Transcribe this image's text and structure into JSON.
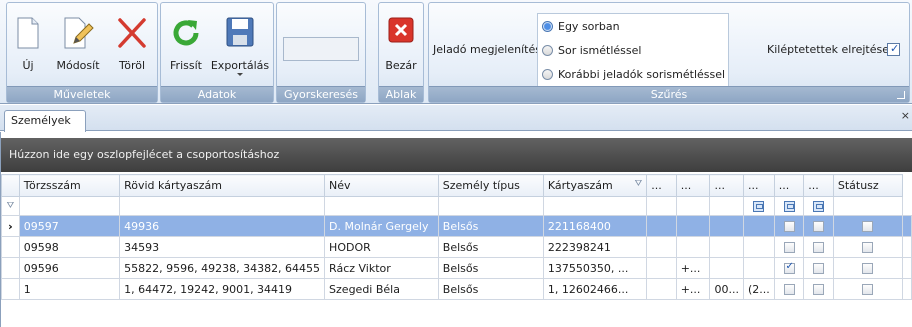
{
  "ribbon": {
    "groups": {
      "muveletek": "Műveletek",
      "adatok": "Adatok",
      "gyorskereses": "Gyorskeresés",
      "ablak": "Ablak",
      "szures": "Szűrés"
    },
    "buttons": {
      "uj": "Új",
      "modosit": "Módosít",
      "torol": "Töröl",
      "frissit": "Frissít",
      "exportalas": "Exportálás",
      "bezar": "Bezár"
    },
    "search_value": "",
    "jelado_label": "Jeladó megjelenítés",
    "radio_options": [
      "Egy sorban",
      "Sor ismétléssel",
      "Korábbi jeladók sorismétléssel"
    ],
    "selected_radio": "Egy sorban",
    "kileptetettek_label": "Kiléptetettek elrejtése",
    "kileptetettek_checked": true
  },
  "tab": {
    "label": "Személyek"
  },
  "grid": {
    "group_hint": "Húzzon ide egy oszlopfejlécet a csoportosításhoz",
    "columns": [
      "Törzsszám",
      "Rövid kártyaszám",
      "Név",
      "Személy típus",
      "Kártyaszám",
      "...",
      "...",
      "...",
      "...",
      "...",
      "...",
      "Státusz"
    ],
    "rows": [
      {
        "torzsszam": "09597",
        "rovid": "49936",
        "nev": "D. Molnár Gergely",
        "tipus": "Belsős",
        "kartya": "221168400",
        "c1": "",
        "c2": "",
        "c3": "",
        "k1": false,
        "k2": false,
        "k3": false,
        "status": "",
        "selected": true
      },
      {
        "torzsszam": "09598",
        "rovid": "34593",
        "nev": "HODOR",
        "tipus": "Belsős",
        "kartya": "222398241",
        "c1": "",
        "c2": "",
        "c3": "",
        "k1": false,
        "k2": false,
        "k3": false,
        "status": "",
        "selected": false
      },
      {
        "torzsszam": "09596",
        "rovid": "55822, 9596, 49238, 34382, 64455",
        "nev": "Rácz Viktor",
        "tipus": "Belsős",
        "kartya": "137550350, ...",
        "c1": "+...",
        "c2": "",
        "c3": "",
        "k1": true,
        "k2": false,
        "k3": false,
        "status": "",
        "selected": false
      },
      {
        "torzsszam": "1",
        "rovid": "1, 64472, 19242, 9001, 34419",
        "nev": "Szegedi Béla",
        "tipus": "Belsős",
        "kartya": "1, 12602466...",
        "c1": "+...",
        "c2": "00...",
        "c3": "(2...",
        "k1": false,
        "k2": false,
        "k3": false,
        "status": "",
        "selected": false
      }
    ]
  },
  "colors": {
    "selection": "#8fb1e5",
    "ribbon_title": "#8ea6c4",
    "group_panel": "#4a4a4a"
  }
}
